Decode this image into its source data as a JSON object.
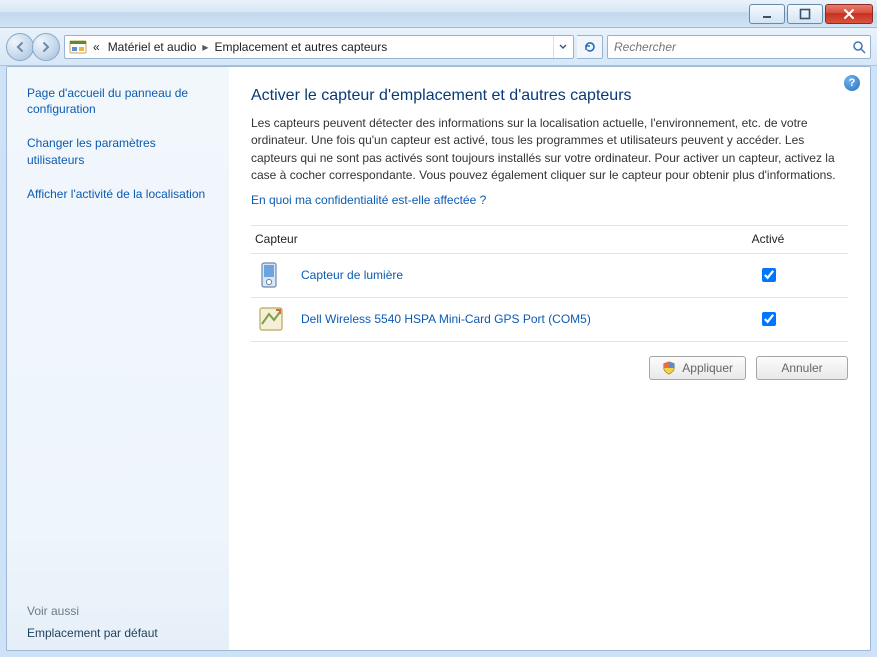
{
  "titlebar": {},
  "toolbar": {
    "crumb_prefix": "«",
    "crumb1": "Matériel et audio",
    "crumb2": "Emplacement et autres capteurs",
    "search_placeholder": "Rechercher"
  },
  "sidebar": {
    "links": [
      "Page d'accueil du panneau de configuration",
      "Changer les paramètres utilisateurs",
      "Afficher l'activité de la localisation"
    ],
    "see_also_label": "Voir aussi",
    "related": "Emplacement par défaut"
  },
  "main": {
    "heading": "Activer le capteur d'emplacement et d'autres capteurs",
    "paragraph": "Les capteurs peuvent détecter des informations sur la localisation actuelle, l'environnement, etc. de votre ordinateur. Une fois qu'un capteur est activé, tous les programmes et utilisateurs peuvent y accéder. Les capteurs qui ne sont pas activés sont toujours installés sur votre ordinateur. Pour activer un capteur, activez la case à cocher correspondante. Vous pouvez également cliquer sur le capteur pour obtenir plus d'informations.",
    "privacy_link": "En quoi ma confidentialité est-elle affectée ?",
    "columns": {
      "sensor": "Capteur",
      "enabled": "Activé"
    },
    "rows": [
      {
        "label": "Capteur de lumière",
        "enabled": true,
        "icon": "light-sensor-icon"
      },
      {
        "label": "Dell Wireless 5540 HSPA Mini-Card GPS Port (COM5)",
        "enabled": true,
        "icon": "gps-sensor-icon"
      }
    ],
    "apply_label": "Appliquer",
    "cancel_label": "Annuler"
  }
}
